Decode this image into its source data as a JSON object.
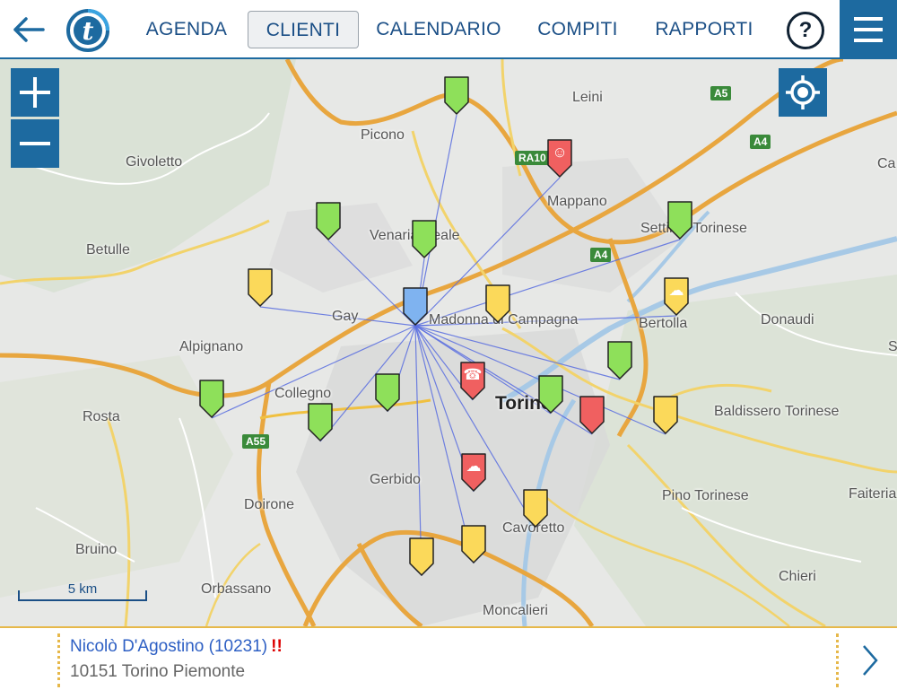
{
  "nav": {
    "tabs": [
      {
        "label": "AGENDA",
        "active": false
      },
      {
        "label": "CLIENTI",
        "active": true
      },
      {
        "label": "CALENDARIO",
        "active": false
      },
      {
        "label": "COMPITI",
        "active": false
      },
      {
        "label": "RAPPORTI",
        "active": false
      }
    ],
    "help_label": "?",
    "logo_letter": "t"
  },
  "map": {
    "places": [
      "Leini",
      "Picono",
      "Givoletto",
      "Mappano",
      "Venaria Reale",
      "Settimo Torinese",
      "Betulle",
      "Gay",
      "Madonna di Campagna",
      "Bertolla",
      "Donaudi",
      "Alpignano",
      "Collegno",
      "Torino",
      "Baldissero Torinese",
      "Rosta",
      "Gerbido",
      "Pino Torinese",
      "Faiteria",
      "Doirone",
      "Cavoretto",
      "Bruino",
      "Chieri",
      "Orbassano",
      "Moncalieri",
      "Ca",
      "S"
    ],
    "road_shields": [
      "A5",
      "A4",
      "RA10",
      "A4",
      "A55"
    ],
    "scale_label": "5 km",
    "colors": {
      "green": "#8ee05a",
      "yellow": "#fbd95a",
      "red": "#f06060",
      "blue": "#7fb3f0",
      "route": "#5a6ee0"
    },
    "pins": [
      {
        "color": "green",
        "icon": ""
      },
      {
        "color": "red",
        "icon": "smile-icon"
      },
      {
        "color": "green",
        "icon": ""
      },
      {
        "color": "green",
        "icon": ""
      },
      {
        "color": "green",
        "icon": ""
      },
      {
        "color": "yellow",
        "icon": ""
      },
      {
        "color": "yellow",
        "icon": ""
      },
      {
        "color": "yellow",
        "icon": "cloud-icon"
      },
      {
        "color": "green",
        "icon": ""
      },
      {
        "color": "red",
        "icon": "phone-icon"
      },
      {
        "color": "green",
        "icon": ""
      },
      {
        "color": "green",
        "icon": ""
      },
      {
        "color": "green",
        "icon": ""
      },
      {
        "color": "green",
        "icon": ""
      },
      {
        "color": "red",
        "icon": ""
      },
      {
        "color": "yellow",
        "icon": ""
      },
      {
        "color": "red",
        "icon": "cloud-icon"
      },
      {
        "color": "yellow",
        "icon": ""
      },
      {
        "color": "yellow",
        "icon": ""
      },
      {
        "color": "yellow",
        "icon": ""
      },
      {
        "color": "blue",
        "icon": "",
        "center": true
      }
    ]
  },
  "selected": {
    "name": "Nicolò D'Agostino (10231)",
    "flag": "!!",
    "address": "10151 Torino Piemonte"
  }
}
